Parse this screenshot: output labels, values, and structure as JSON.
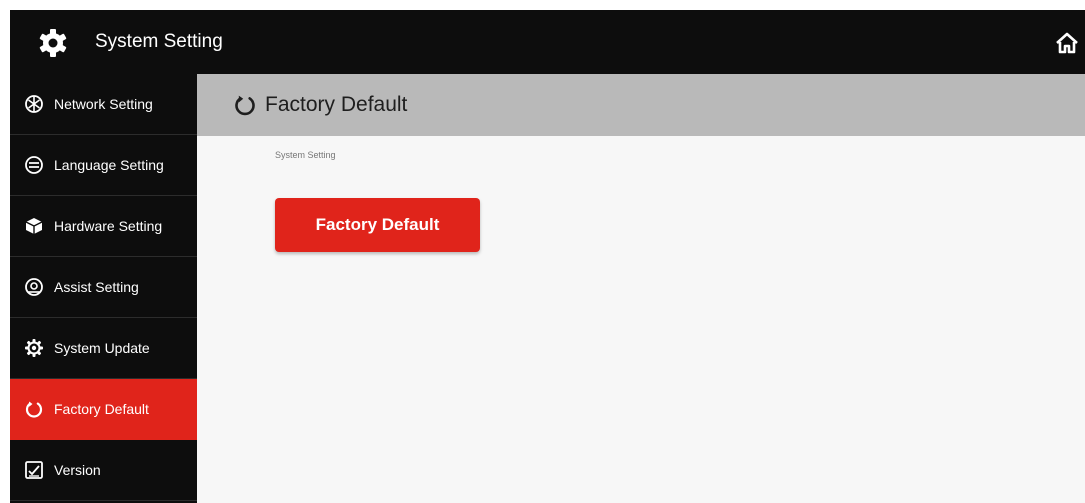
{
  "header": {
    "title": "System Setting",
    "icons": {
      "settings": "gear-icon",
      "home": "home-icon"
    }
  },
  "sidebar": {
    "items": [
      {
        "label": "Network Setting",
        "icon": "network-icon",
        "active": false
      },
      {
        "label": "Language Setting",
        "icon": "language-icon",
        "active": false
      },
      {
        "label": "Hardware Setting",
        "icon": "hardware-icon",
        "active": false
      },
      {
        "label": "Assist Setting",
        "icon": "assist-icon",
        "active": false
      },
      {
        "label": "System Update",
        "icon": "update-icon",
        "active": false
      },
      {
        "label": "Factory Default",
        "icon": "reset-icon",
        "active": true
      },
      {
        "label": "Version",
        "icon": "version-icon",
        "active": false
      }
    ]
  },
  "main": {
    "title": "Factory Default",
    "breadcrumb": "System Setting",
    "button_label": "Factory Default"
  },
  "colors": {
    "accent": "#e0241b",
    "topbar": "#0d0d0d",
    "section_header": "#b9b9b9",
    "content_bg": "#f7f7f7"
  }
}
